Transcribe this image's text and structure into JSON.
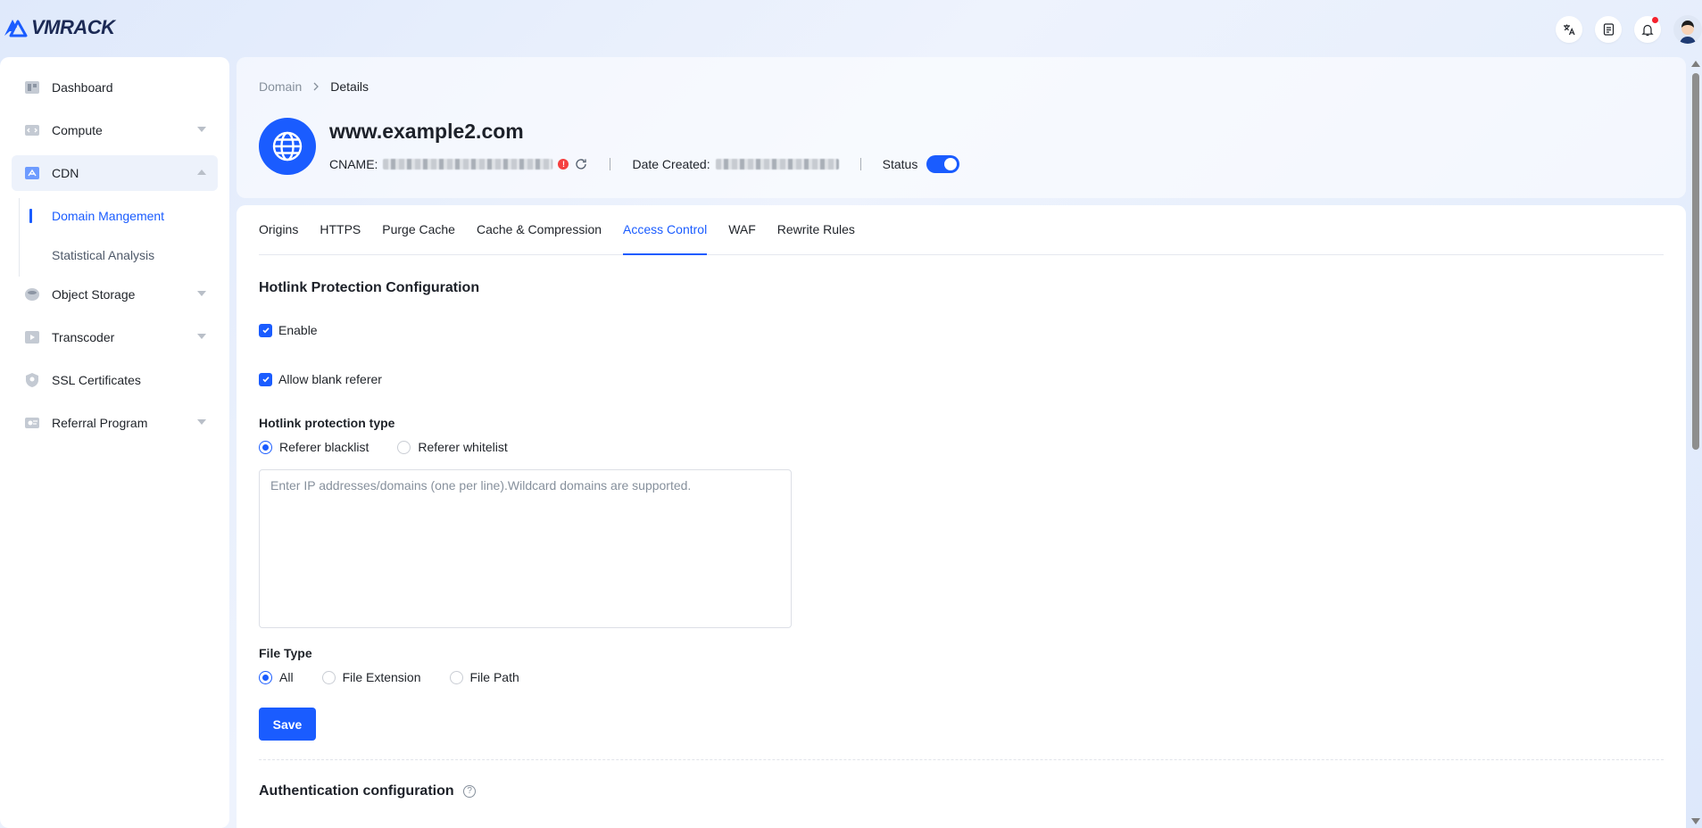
{
  "brand": {
    "name": "VMRACK",
    "accent": "#1a5cff"
  },
  "header_icons": [
    {
      "name": "translate-icon"
    },
    {
      "name": "document-icon"
    },
    {
      "name": "bell-icon",
      "has_notification": true
    },
    {
      "name": "user-avatar"
    }
  ],
  "sidebar": {
    "items": [
      {
        "label": "Dashboard",
        "icon": "dashboard-icon",
        "expandable": false
      },
      {
        "label": "Compute",
        "icon": "compute-icon",
        "expandable": true
      },
      {
        "label": "CDN",
        "icon": "cdn-icon",
        "expandable": true,
        "expanded": true,
        "children": [
          {
            "label": "Domain Mangement",
            "active": true
          },
          {
            "label": "Statistical Analysis",
            "active": false
          }
        ]
      },
      {
        "label": "Object Storage",
        "icon": "object-storage-icon",
        "expandable": true
      },
      {
        "label": "Transcoder",
        "icon": "transcoder-icon",
        "expandable": true
      },
      {
        "label": "SSL Certificates",
        "icon": "ssl-certificate-icon",
        "expandable": false
      },
      {
        "label": "Referral Program",
        "icon": "referral-icon",
        "expandable": true
      }
    ]
  },
  "breadcrumb": {
    "parent": "Domain",
    "separator": ">",
    "current": "Details"
  },
  "domain": {
    "title": "www.example2.com",
    "cname_label": "CNAME:",
    "date_created_label": "Date Created:",
    "status_label": "Status",
    "status_enabled": true
  },
  "tabs": [
    {
      "label": "Origins",
      "active": false
    },
    {
      "label": "HTTPS",
      "active": false
    },
    {
      "label": "Purge Cache",
      "active": false
    },
    {
      "label": "Cache & Compression",
      "active": false
    },
    {
      "label": "Access Control",
      "active": true
    },
    {
      "label": "WAF",
      "active": false
    },
    {
      "label": "Rewrite Rules",
      "active": false
    }
  ],
  "hotlink": {
    "title": "Hotlink Protection Configuration",
    "enable_label": "Enable",
    "enable_checked": true,
    "allow_blank_label": "Allow blank referer",
    "allow_blank_checked": true,
    "type_label": "Hotlink protection type",
    "type_options": [
      "Referer blacklist",
      "Referer whitelist"
    ],
    "type_selected": "Referer blacklist",
    "textarea_value": "",
    "textarea_placeholder": "Enter IP addresses/domains (one per line).Wildcard domains are supported.",
    "file_type_label": "File Type",
    "file_type_options": [
      "All",
      "File Extension",
      "File Path"
    ],
    "file_type_selected": "All",
    "save_label": "Save"
  },
  "auth": {
    "title": "Authentication configuration"
  }
}
